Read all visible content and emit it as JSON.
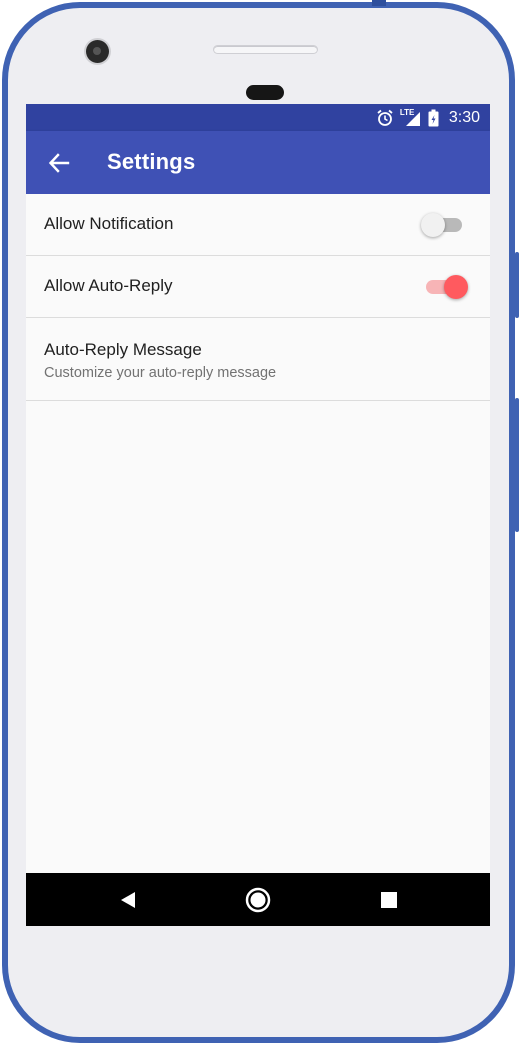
{
  "status_bar": {
    "time": "3:30",
    "icons": [
      "alarm-icon",
      "lte-signal-icon",
      "battery-icon"
    ],
    "network_label": "LTE"
  },
  "app_bar": {
    "title": "Settings",
    "back_icon": "arrow-back-icon"
  },
  "settings": {
    "allow_notification": {
      "label": "Allow Notification",
      "enabled": false
    },
    "allow_auto_reply": {
      "label": "Allow Auto-Reply",
      "enabled": true
    },
    "auto_reply_message": {
      "label": "Auto-Reply Message",
      "summary": "Customize your auto-reply message"
    }
  },
  "navigation_bar": {
    "buttons": [
      "nav-back-icon",
      "nav-home-icon",
      "nav-recents-icon"
    ]
  },
  "colors": {
    "primary": "#3f51b5",
    "primary_dark": "#3042a0",
    "accent": "#ff5a5f",
    "frame": "#3f62b3"
  }
}
